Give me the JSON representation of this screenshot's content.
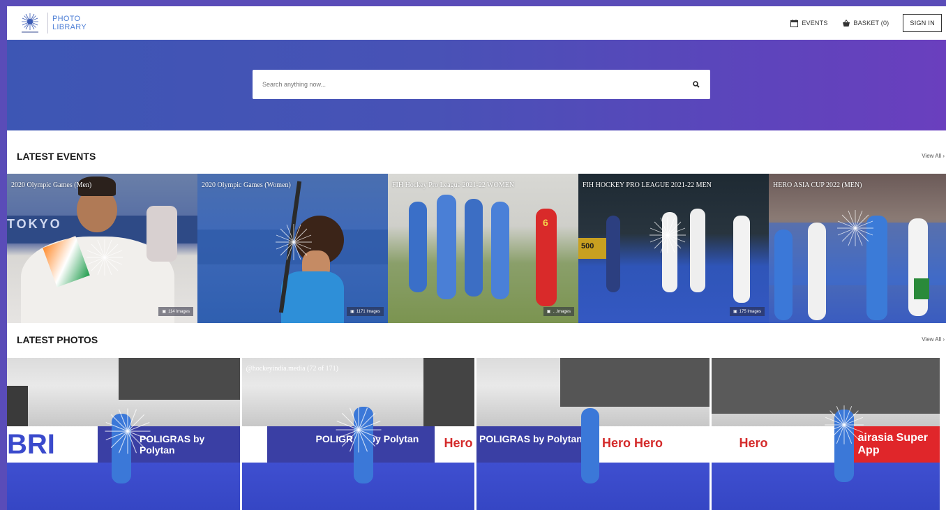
{
  "header": {
    "logo_line1": "PHOTO",
    "logo_line2": "LIBRARY",
    "nav": {
      "events_label": "EVENTS",
      "basket_label": "BASKET (0)",
      "signin_label": "SIGN IN"
    }
  },
  "search": {
    "placeholder": "Search anything now..."
  },
  "latest_events": {
    "title": "LATEST EVENTS",
    "view_all": "View All ›",
    "items": [
      {
        "caption": "2020 Olympic Games (Men)",
        "count": "114 Images"
      },
      {
        "caption": "2020 Olympic Games (Women)",
        "count": "1171 Images"
      },
      {
        "caption": "FIH Hockey Pro League 2021-22 WOMEN",
        "count": "…Images"
      },
      {
        "caption": "FIH HOCKEY PRO LEAGUE 2021-22 MEN",
        "count": "175 Images"
      },
      {
        "caption": "HERO ASIA CUP 2022 (MEN)",
        "count": ""
      }
    ]
  },
  "latest_photos": {
    "title": "LATEST PHOTOS",
    "view_all": "View All ›",
    "items": [
      {
        "caption": "",
        "board_left": "BRI",
        "board_right": "POLIGRAS by Polytan"
      },
      {
        "caption": "@hockeyindia.media (72 of 171)",
        "board_left": "POLIGRAS by Polytan",
        "board_right": "Hero"
      },
      {
        "caption": "",
        "board_left": "POLIGRAS by Polytan",
        "board_right": "Hero Hero"
      },
      {
        "caption": "",
        "board_left": "Hero",
        "board_right": "airasia Super App"
      }
    ]
  },
  "colors": {
    "hero_start": "#3d56b4",
    "hero_end": "#6a3fbe",
    "logo_blue": "#4e7fd6",
    "turf_blue": "#3a4acc"
  }
}
